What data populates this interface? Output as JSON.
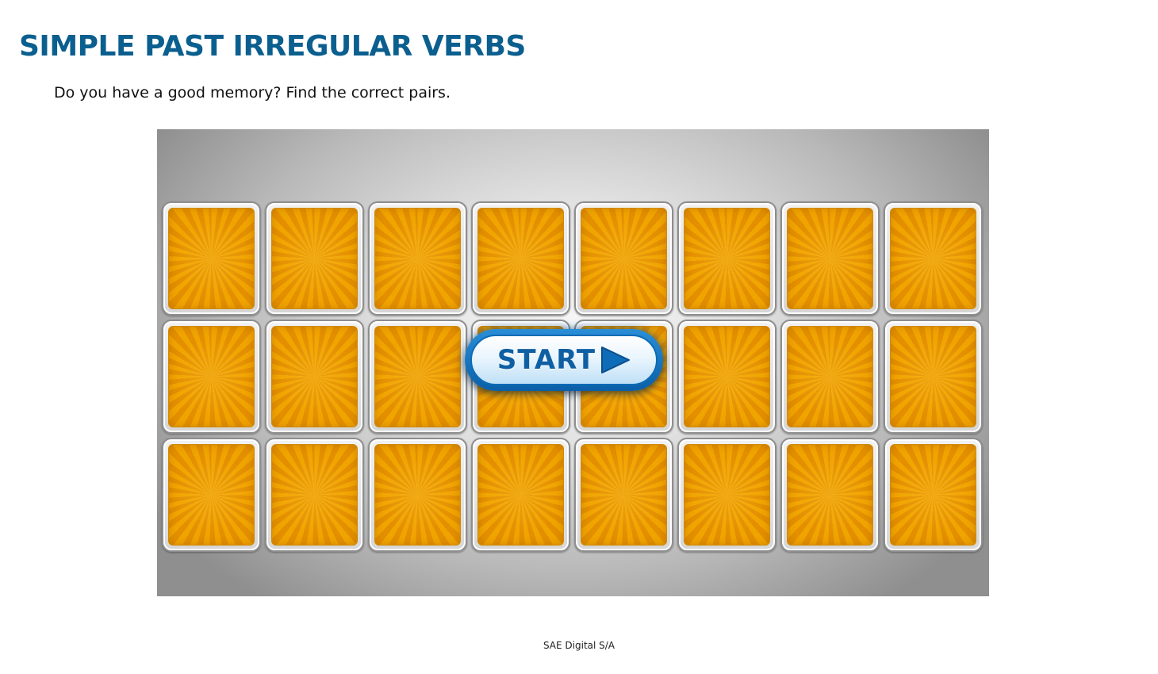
{
  "header": {
    "title": "SIMPLE PAST IRREGULAR VERBS",
    "instructions": "Do you have a good memory? Find the correct pairs."
  },
  "game": {
    "grid": {
      "rows": 3,
      "columns": 8
    },
    "card_state": "face-down",
    "start_label": "START",
    "start_icon": "play-arrow-icon",
    "colors": {
      "card_back": "#f0a400",
      "button_blue": "#0f5fa3"
    }
  },
  "footer": {
    "credit": "SAE Digital S/A"
  }
}
